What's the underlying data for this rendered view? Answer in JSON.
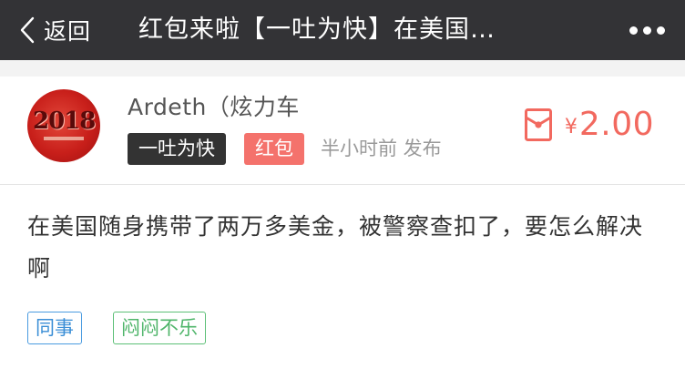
{
  "colors": {
    "navbar_bg": "#333336",
    "accent_red": "#f2695f",
    "tag_dark_bg": "#333333",
    "tag_red_bg": "#f4726c",
    "chip_blue": "#3a8ed6",
    "chip_green": "#4fb56a"
  },
  "navbar": {
    "back_label": "返回",
    "back_icon": "chevron-left-icon",
    "title": "红包来啦【一吐为快】在美国…",
    "more_icon": "more-dots-icon"
  },
  "post": {
    "avatar_icon": "user-avatar",
    "avatar_text": "2018",
    "username": "Ardeth（炫力车",
    "category_tag": "一吐为快",
    "type_tag": "红包",
    "time_text": "半小时前 发布",
    "reward": {
      "icon": "red-envelope-icon",
      "currency": "¥",
      "amount": "2.00"
    },
    "content": "在美国随身携带了两万多美金，被警察查扣了，要怎么解决啊",
    "tags": [
      "同事",
      "闷闷不乐"
    ]
  }
}
